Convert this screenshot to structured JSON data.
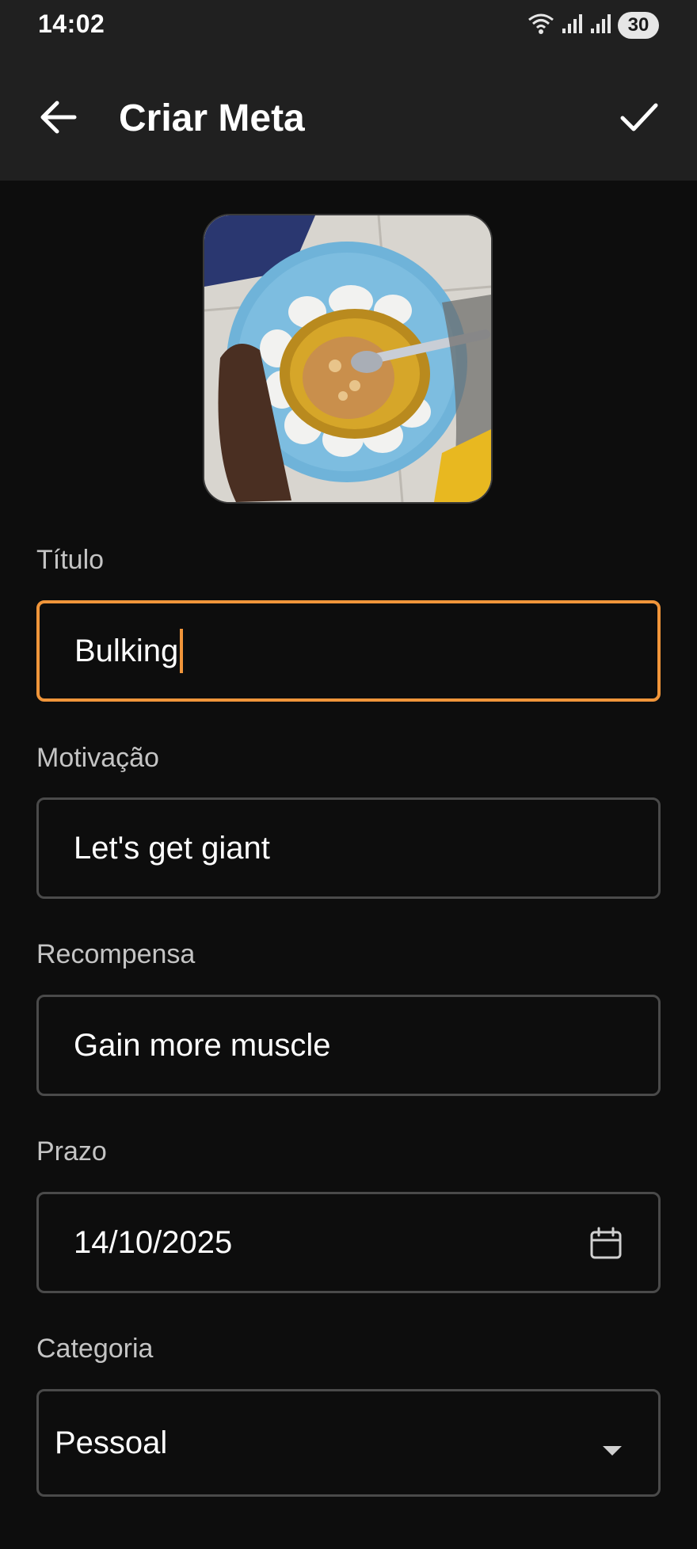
{
  "status_bar": {
    "time": "14:02",
    "battery": "30",
    "icons": [
      "wifi-icon",
      "signal-icon",
      "signal-icon",
      "battery-icon"
    ]
  },
  "app_bar": {
    "title": "Criar Meta",
    "back_icon": "arrow-left-icon",
    "save_icon": "check-icon"
  },
  "form": {
    "titulo": {
      "label": "Título",
      "value": "Bulking"
    },
    "motivacao": {
      "label": "Motivação",
      "value": "Let's get giant"
    },
    "recompensa": {
      "label": "Recompensa",
      "value": "Gain more muscle"
    },
    "prazo": {
      "label": "Prazo",
      "value": "14/10/2025",
      "icon": "calendar-icon"
    },
    "categoria": {
      "label": "Categoria",
      "value": "Pessoal",
      "icon": "dropdown-arrow-icon"
    }
  },
  "colors": {
    "background": "#0d0d0d",
    "app_bar": "#202020",
    "accent": "#f0953a",
    "field_border": "#4a4a4a",
    "label": "#c4c4c4"
  }
}
